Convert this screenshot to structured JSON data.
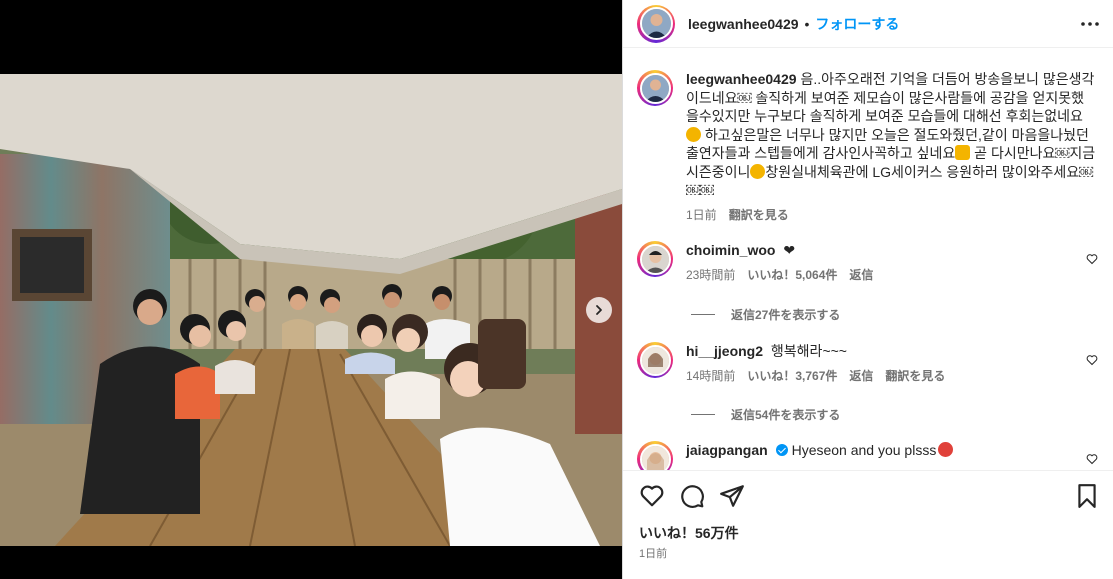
{
  "post": {
    "author": "leegwanhee0429",
    "separator": "•",
    "follow_label": "フォローする",
    "more_icon": "more-horizontal-icon"
  },
  "caption": {
    "username": "leegwanhee0429",
    "text": "음..아주오래전 기억을 더듬어 방송을보니 많은생각이드네요￼ 솔직하게 보여준 제모습이 많은사람들에 공감을 얻지못했을수있지만 누구보다 솔직하게 보여준 모습들에 대해선 후회는없네요",
    "text_2": " 하고싶은말은 너무나 많지만 오늘은 절도와줬던,같이 마음을나눴던 출연자들과 스텝들에게 감사인사꼭하고 싶네요",
    "text_3": " 곧 다시만나요￼지금 시즌중이니",
    "text_4": "창원실내체육관에 LG세이커스 응원하러 많이와주세요￼￼￼",
    "time": "1日前",
    "translate_label": "翻訳を見る"
  },
  "comments": [
    {
      "username": "choimin_woo",
      "text": "❤",
      "time": "23時間前",
      "likes": "いいね！5,064件",
      "reply_label": "返信",
      "replies_label": "返信27件を表示する"
    },
    {
      "username": "hi__jjeong2",
      "text": "행복해라~~~",
      "time": "14時間前",
      "likes": "いいね！3,767件",
      "reply_label": "返信",
      "translate_label": "翻訳を見る",
      "replies_label": "返信54件を表示する"
    },
    {
      "username": "jaiagpangan",
      "text": "Hyeseon and you plsss",
      "verified": true
    }
  ],
  "actions": {
    "like_icon": "heart-icon",
    "comment_icon": "comment-icon",
    "share_icon": "send-icon",
    "save_icon": "bookmark-icon",
    "likes_label": "いいね！56万件",
    "time": "1日前"
  },
  "carousel": {
    "total": 10,
    "active_index": 0,
    "next_icon": "chevron-right-icon"
  },
  "colors": {
    "link_blue": "#0095f6",
    "text": "#262626",
    "secondary": "#737373"
  }
}
